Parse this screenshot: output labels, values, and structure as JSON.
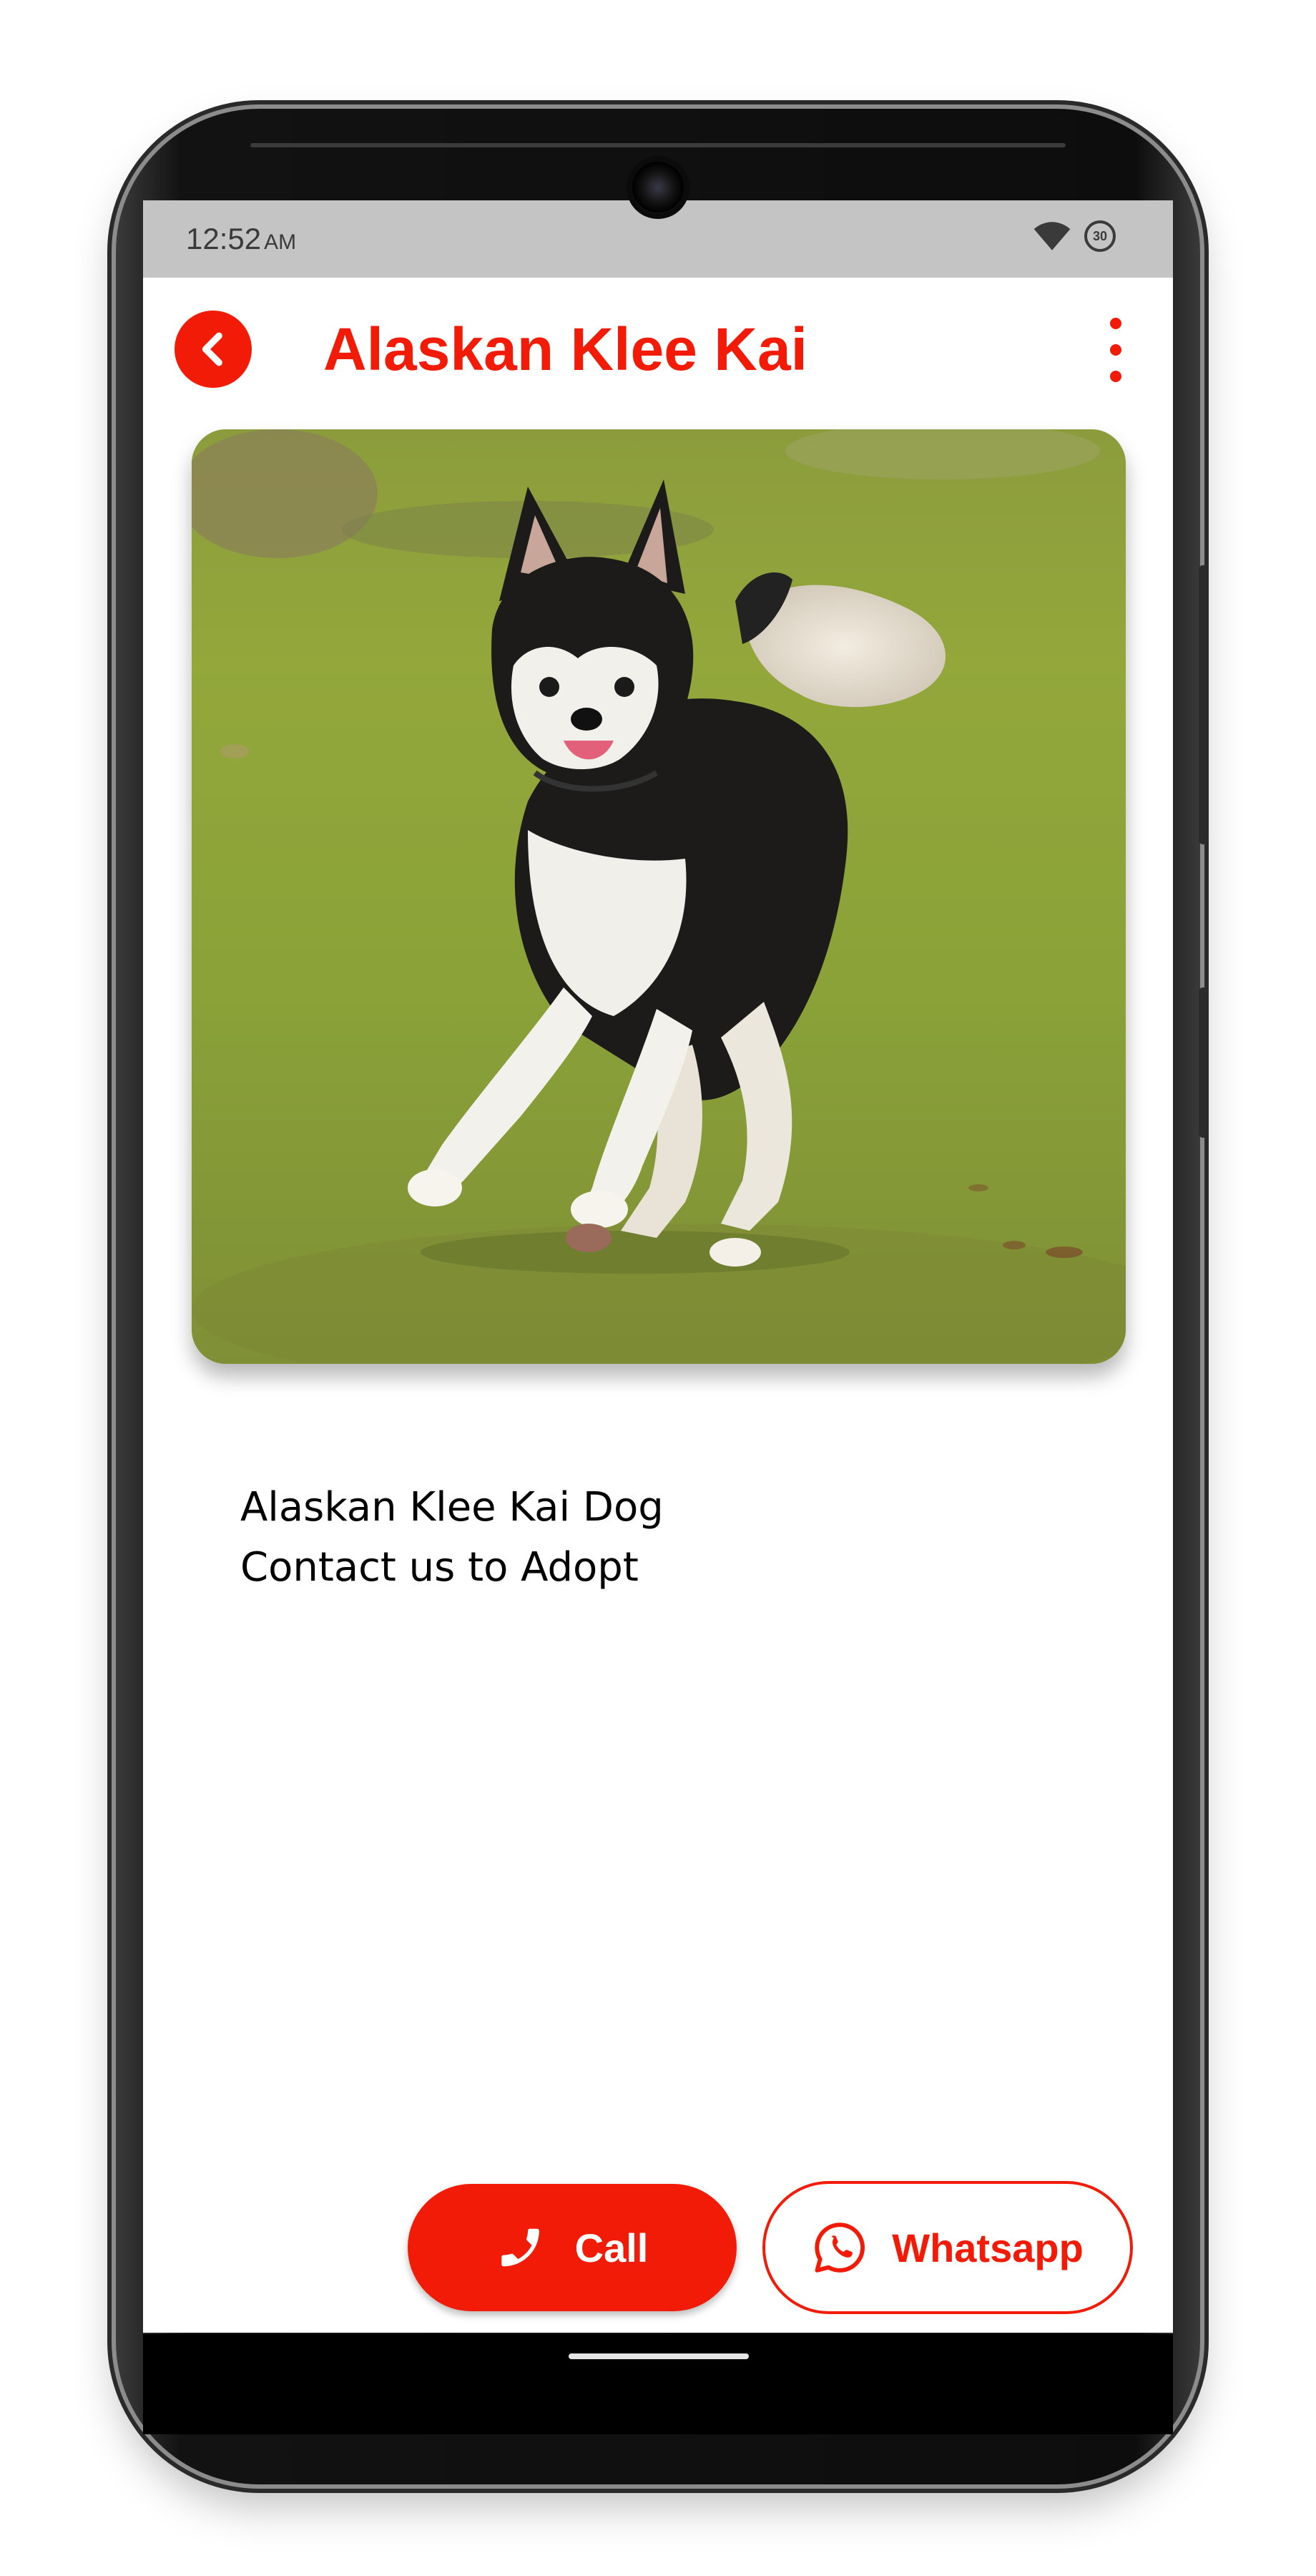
{
  "status_bar": {
    "time": "12:52",
    "ampm": "AM",
    "battery_label": "30",
    "icons": [
      "wifi-icon",
      "battery-saver-icon"
    ]
  },
  "app_bar": {
    "title": "Alaskan Klee Kai",
    "back_icon": "chevron-left-icon",
    "menu_icon": "more-vertical-icon"
  },
  "content": {
    "photo_subject": "dog-photo",
    "description_lines": [
      "Alaskan Klee Kai Dog",
      "Contact us to Adopt"
    ]
  },
  "actions": {
    "call_label": "Call",
    "call_icon": "phone-icon",
    "whatsapp_label": "Whatsapp",
    "whatsapp_icon": "whatsapp-icon"
  },
  "colors": {
    "accent": "#f21b07",
    "status_bar_bg": "#c4c4c4",
    "background": "#ffffff"
  }
}
